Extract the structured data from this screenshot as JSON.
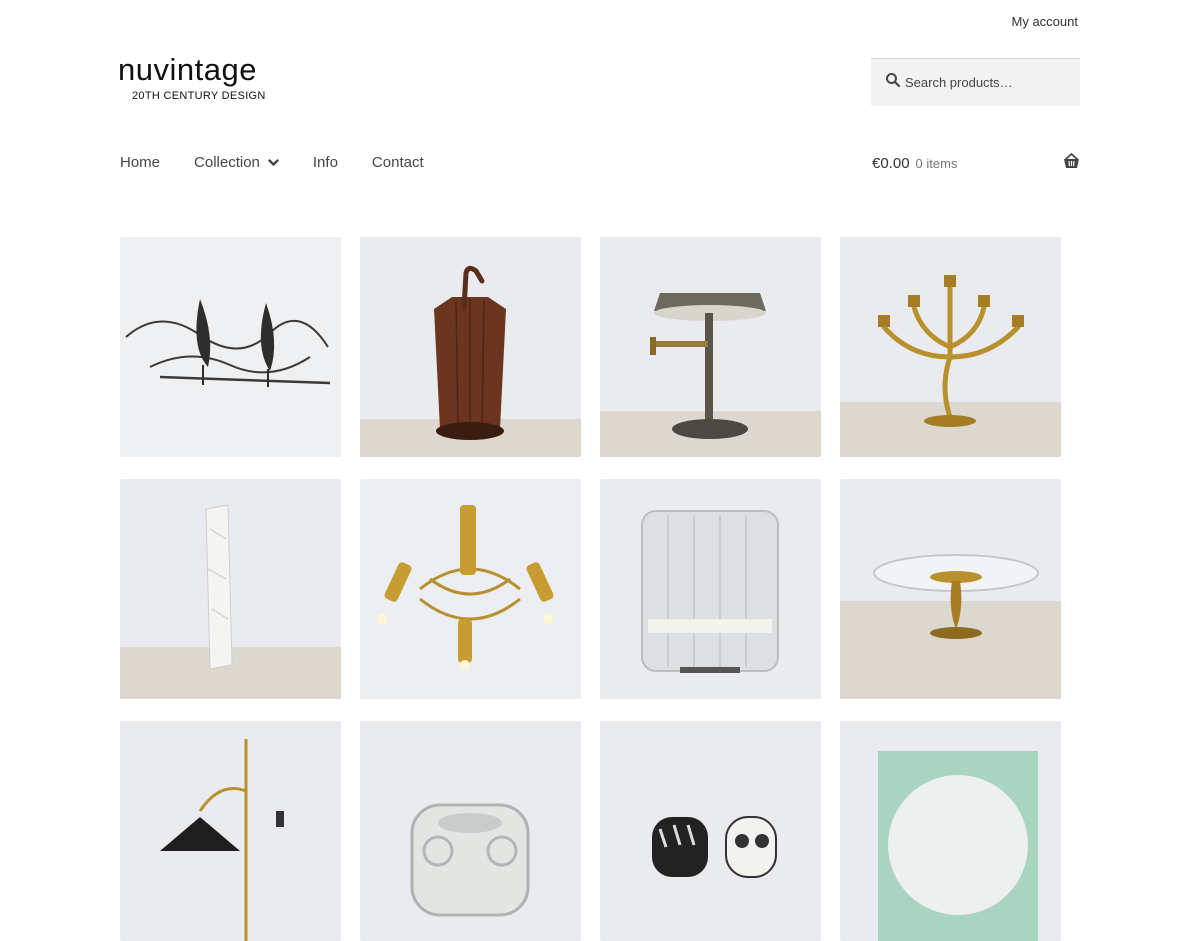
{
  "header": {
    "account_link": "My account",
    "logo": {
      "wordmark": "nuvintage",
      "tagline": "20TH CENTURY DESIGN"
    },
    "search": {
      "placeholder": "Search products…",
      "icon": "search-icon"
    }
  },
  "nav": {
    "items": [
      {
        "label": "Home"
      },
      {
        "label": "Collection",
        "has_dropdown": true
      },
      {
        "label": "Info"
      },
      {
        "label": "Contact"
      }
    ]
  },
  "cart": {
    "amount": "€0.00",
    "count": "0 items",
    "icon": "basket-icon"
  },
  "products": [
    {
      "image": "metal-cypress-trees-wall-sculpture"
    },
    {
      "image": "teak-umbrella-stand"
    },
    {
      "image": "swing-arm-desk-lamp"
    },
    {
      "image": "brass-candelabra"
    },
    {
      "image": "white-ceramic-vase"
    },
    {
      "image": "brass-ceiling-lamp"
    },
    {
      "image": "ice-glass-wall-sconce"
    },
    {
      "image": "glass-dish-on-brass-stand"
    },
    {
      "image": "black-brass-floor-lamp"
    },
    {
      "image": "glass-candle-holder"
    },
    {
      "image": "ceramic-owl-figurines"
    },
    {
      "image": "green-glass-mirror"
    }
  ],
  "colors": {
    "text": "#43454b",
    "tile_bg": "#e9ebee",
    "brass": "#b8902e"
  }
}
